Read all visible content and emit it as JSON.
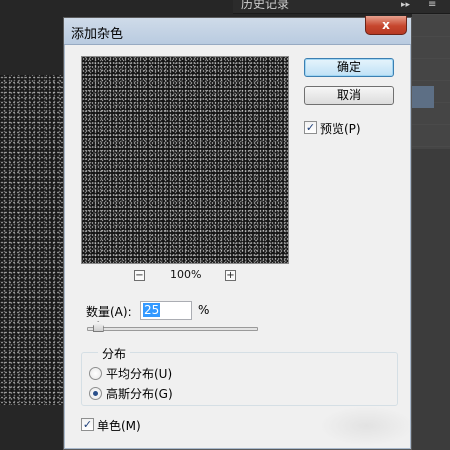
{
  "history_panel": {
    "tab_label": "历史记录",
    "arrows_icon": "double-arrow-right-icon",
    "menu_icon": "panel-menu-icon"
  },
  "dialog": {
    "title": "添加杂色",
    "close_label": "x",
    "ok_label": "确定",
    "cancel_label": "取消",
    "preview_checkbox": {
      "label": "预览(P)",
      "checked": true
    },
    "zoom": {
      "minus": "−",
      "plus": "+",
      "level": "100%"
    },
    "amount": {
      "label": "数量(A):",
      "value": "25",
      "unit": "%",
      "slider_fraction": 0.0625
    },
    "distribution": {
      "legend": "分布",
      "options": [
        {
          "label": "平均分布(U)",
          "selected": false
        },
        {
          "label": "高斯分布(G)",
          "selected": true
        }
      ]
    },
    "monochromatic": {
      "label": "单色(M)",
      "checked": true
    }
  },
  "colors": {
    "titlebar": "#c5d5e8",
    "close_button": "#c6462e",
    "default_button": "#bfe1f6",
    "selection": "#3399ff"
  }
}
